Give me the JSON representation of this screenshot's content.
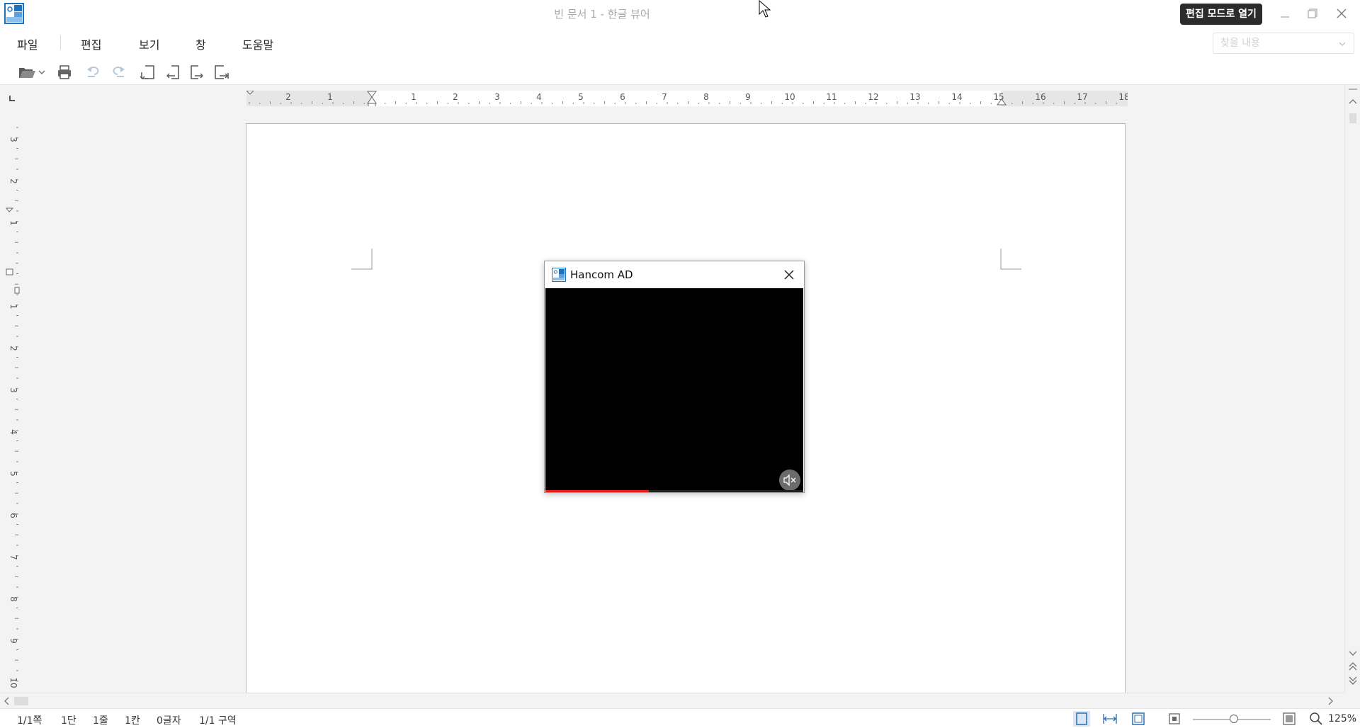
{
  "window": {
    "title": "빈 문서 1 - 한글 뷰어",
    "edit_mode_label": "편집 모드로 열기"
  },
  "menu": {
    "items": [
      "파일",
      "편집",
      "보기",
      "창",
      "도움말"
    ]
  },
  "search": {
    "placeholder": "찾을 내용"
  },
  "toolbar": {
    "icons": [
      "open-folder-icon",
      "dropdown-arrow-icon",
      "print-icon",
      "undo-icon",
      "redo-icon",
      "page-first-icon",
      "page-prev-icon",
      "page-next-icon",
      "page-last-icon"
    ]
  },
  "ruler": {
    "horizontal_labels": [
      "2",
      "1",
      "1",
      "2",
      "3",
      "4",
      "5",
      "6",
      "7",
      "8",
      "9",
      "10",
      "11",
      "12",
      "13",
      "14",
      "15",
      "16",
      "17",
      "18"
    ],
    "vertical_labels": [
      "3",
      "2",
      "1",
      "1",
      "2",
      "3",
      "4",
      "5",
      "6",
      "7",
      "8",
      "9",
      "10"
    ]
  },
  "ad_popup": {
    "title": "Hancom AD",
    "progress": 0.4
  },
  "status": {
    "page": "1/1쪽",
    "column": "1단",
    "line": "1줄",
    "cell": "1칸",
    "chars": "0글자",
    "section": "1/1 구역",
    "zoom": "125%"
  },
  "colors": {
    "accent": "#1e73be",
    "progress": "#e31c1c",
    "edit_btn_bg": "#2b2b2b"
  }
}
